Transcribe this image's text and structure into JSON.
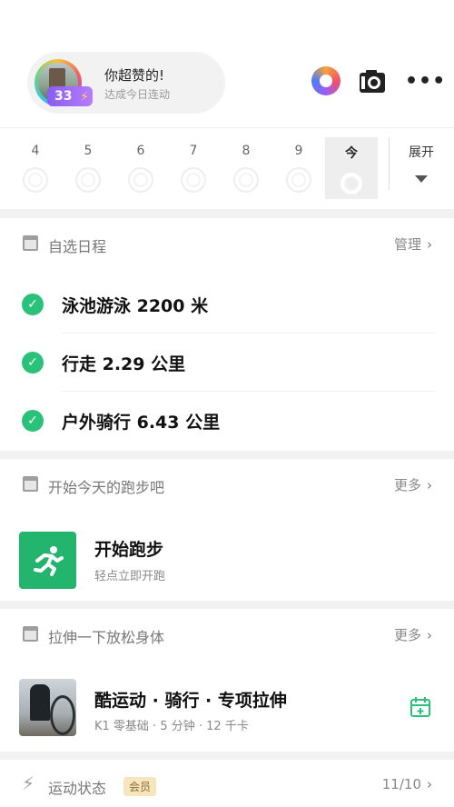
{
  "header": {
    "level": "33",
    "greeting_title": "你超赞的!",
    "greeting_sub": "达成今日连动"
  },
  "week": {
    "days": [
      "4",
      "5",
      "6",
      "7",
      "8",
      "9",
      "今"
    ],
    "expand_label": "展开"
  },
  "schedule": {
    "title": "自选日程",
    "manage_label": "管理",
    "items": [
      "泳池游泳 2200 米",
      "行走 2.29 公里",
      "户外骑行 6.43 公里"
    ]
  },
  "run": {
    "title": "开始今天的跑步吧",
    "more_label": "更多",
    "item_title": "开始跑步",
    "item_sub": "轻点立即开跑"
  },
  "stretch": {
    "title": "拉伸一下放松身体",
    "more_label": "更多",
    "item_title": "酷运动 · 骑行 · 专项拉伸",
    "item_sub": "K1 零基础 · 5 分钟 · 12 千卡"
  },
  "status": {
    "title": "运动状态",
    "badge": "会员",
    "date_label": "11/10"
  },
  "colors": {
    "accent_green": "#2ac17a",
    "run_tile": "#23b46e",
    "level_purple": "#8a5cf5"
  }
}
